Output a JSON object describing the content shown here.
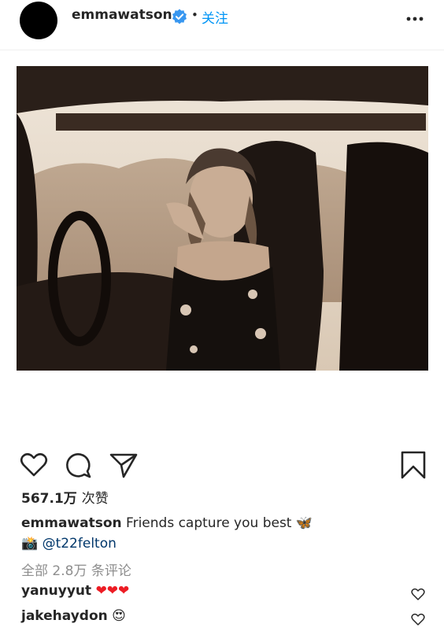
{
  "post_header": {
    "username": "emmawatson",
    "separator": "•",
    "follow_label": "关注",
    "verified_icon": "verified-badge-icon",
    "more_icon": "more-options-icon"
  },
  "actions": {
    "like_icon": "heart-icon",
    "comment_icon": "comment-icon",
    "share_icon": "share-icon",
    "save_icon": "bookmark-icon"
  },
  "likes": {
    "count": "567.1万",
    "suffix": "次赞"
  },
  "caption": {
    "username": "emmawatson",
    "text": "Friends capture you best",
    "emoji": "🦋",
    "credit_emoji": "📸",
    "mention": "@t22felton"
  },
  "comments_link": "全部 2.8万 条评论",
  "comments": [
    {
      "username": "yanuyyut",
      "text": "❤❤❤"
    },
    {
      "username": "jakehaydon",
      "text": "😍"
    }
  ],
  "colors": {
    "accent": "#0095f6",
    "verified": "#3897f0",
    "heart_red": "#ed1c24",
    "text": "#262626",
    "muted": "#8e8e8e"
  }
}
